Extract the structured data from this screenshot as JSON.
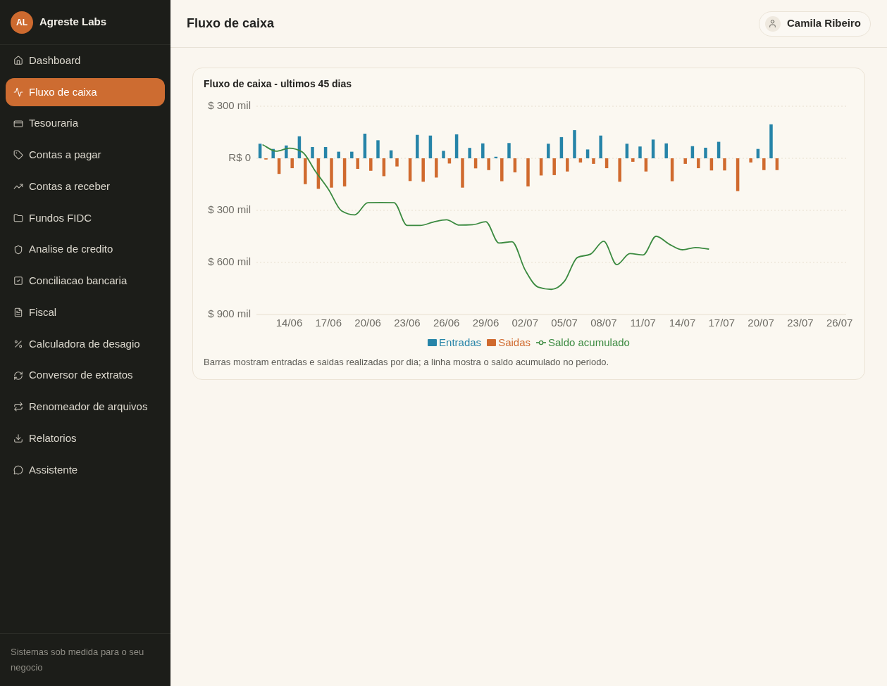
{
  "sidebar": {
    "brand": {
      "initials": "AL",
      "name": "Agreste Labs"
    },
    "items": [
      {
        "label": "Dashboard",
        "selected": false
      },
      {
        "label": "Fluxo de caixa",
        "selected": true
      },
      {
        "label": "Tesouraria",
        "selected": false
      },
      {
        "label": "Contas a pagar",
        "selected": false
      },
      {
        "label": "Contas a receber",
        "selected": false
      },
      {
        "label": "Fundos FIDC",
        "selected": false
      },
      {
        "label": "Analise de credito",
        "selected": false
      },
      {
        "label": "Conciliacao bancaria",
        "selected": false
      },
      {
        "label": "Fiscal",
        "selected": false
      },
      {
        "label": "Calculadora de desagio",
        "selected": false
      },
      {
        "label": "Conversor de extratos",
        "selected": false
      },
      {
        "label": "Renomeador de arquivos",
        "selected": false
      },
      {
        "label": "Relatorios",
        "selected": false
      },
      {
        "label": "Assistente",
        "selected": false
      }
    ],
    "footer": "Sistemas sob medida para o seu negocio"
  },
  "header": {
    "title": "Fluxo de caixa",
    "user": "Camila Ribeiro"
  },
  "card": {
    "chart_data": {
      "type": "bar",
      "title": "Fluxo de caixa - ultimos 45 dias",
      "stacked": false,
      "grid": true,
      "legend": "bottom",
      "categories": [
        null,
        null,
        "14/06",
        null,
        null,
        "17/06",
        null,
        null,
        "20/06",
        null,
        null,
        "23/06",
        null,
        null,
        "26/06",
        null,
        null,
        "29/06",
        null,
        null,
        "02/07",
        null,
        null,
        "05/07",
        null,
        null,
        "08/07",
        null,
        null,
        "11/07",
        null,
        null,
        "14/07",
        null,
        null,
        "17/07",
        null,
        null,
        "20/07",
        null,
        null,
        "23/07",
        null,
        null,
        "26/07"
      ],
      "ylim": [
        -900,
        300
      ],
      "yticks": [
        {
          "value": 300,
          "label": "$ 300 mil"
        },
        {
          "value": 0,
          "label": "R$ 0"
        },
        {
          "value": -300,
          "label": "$ 300 mil"
        },
        {
          "value": -600,
          "label": "$ 600 mil"
        },
        {
          "value": -900,
          "label": "$ 900 mil"
        }
      ],
      "series": [
        {
          "name": "Entradas",
          "color": "#2684a8",
          "type": "bar",
          "values": [
            84,
            54,
            74,
            127,
            65,
            65,
            38,
            38,
            142,
            104,
            46,
            0,
            135,
            131,
            43,
            138,
            60,
            86,
            9,
            88,
            0,
            0,
            84,
            122,
            162,
            51,
            131,
            0,
            84,
            68,
            108,
            86,
            0,
            70,
            61,
            95,
            0,
            0,
            54,
            196,
            null,
            null,
            null,
            null,
            null
          ]
        },
        {
          "name": "Saidas",
          "color": "#d06a2e",
          "type": "bar",
          "values": [
            -7,
            -90,
            -57,
            -149,
            -176,
            -169,
            -162,
            -61,
            -72,
            -103,
            -47,
            -131,
            -135,
            -111,
            -30,
            -169,
            -58,
            -68,
            -132,
            -81,
            -162,
            -99,
            -97,
            -76,
            -24,
            -32,
            -57,
            -135,
            -20,
            -76,
            0,
            -132,
            -32,
            -57,
            -70,
            -70,
            -189,
            -24,
            -68,
            -68,
            null,
            null,
            null,
            null,
            null
          ]
        },
        {
          "name": "Saldo acumulado",
          "color": "#3b8a40",
          "type": "line",
          "values": [
            77,
            41,
            58,
            36,
            -75,
            -179,
            -303,
            -326,
            -256,
            -255,
            -256,
            -387,
            -387,
            -367,
            -354,
            -385,
            -383,
            -365,
            -488,
            -481,
            -643,
            -742,
            -755,
            -709,
            -571,
            -552,
            -478,
            -613,
            -549,
            -557,
            -449,
            -495,
            -527,
            -514,
            -523,
            null,
            null,
            null,
            null,
            null,
            null,
            null,
            null,
            null,
            null
          ]
        }
      ]
    },
    "caption": "Barras mostram entradas e saidas realizadas por dia; a linha mostra o saldo acumulado no periodo."
  }
}
